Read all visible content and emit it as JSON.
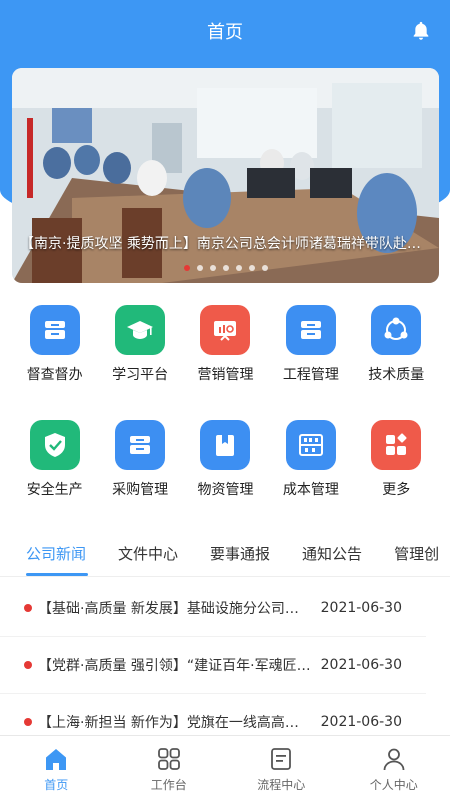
{
  "header": {
    "title": "首页"
  },
  "banner": {
    "caption": "【南京·提质攻坚 乘势而上】南京公司总会计师诸葛瑞祥带队赴前线调研指导",
    "page_count": 7,
    "active_page": 1
  },
  "grid": [
    {
      "label": "督查督办",
      "icon": "tray-icon",
      "color": "#3d8ff2"
    },
    {
      "label": "学习平台",
      "icon": "graduation-cap-icon",
      "color": "#21b97a"
    },
    {
      "label": "营销管理",
      "icon": "presentation-icon",
      "color": "#ef5a4a"
    },
    {
      "label": "工程管理",
      "icon": "tray-icon",
      "color": "#3d8ff2"
    },
    {
      "label": "技术质量",
      "icon": "network-icon",
      "color": "#3d8ff2"
    },
    {
      "label": "安全生产",
      "icon": "shield-check-icon",
      "color": "#21b97a"
    },
    {
      "label": "采购管理",
      "icon": "tray-icon",
      "color": "#3d8ff2"
    },
    {
      "label": "物资管理",
      "icon": "box-icon",
      "color": "#3d8ff2"
    },
    {
      "label": "成本管理",
      "icon": "abacus-icon",
      "color": "#3d8ff2"
    },
    {
      "label": "更多",
      "icon": "apps-icon",
      "color": "#ef5a4a"
    }
  ],
  "tabs": [
    "公司新闻",
    "文件中心",
    "要事通报",
    "通知公告",
    "管理创"
  ],
  "news": [
    {
      "title": "【基础·高质量 新发展】基础设施分公司越来越好",
      "date": "2021-06-30"
    },
    {
      "title": "【党群·高质量 强引领】“建证百年·军魂匠心”",
      "date": "2021-06-30"
    },
    {
      "title": "【上海·新担当 新作为】党旗在一线高高飘扬",
      "date": "2021-06-30"
    }
  ],
  "tabbar": [
    {
      "label": "首页",
      "icon": "home-icon",
      "active": true
    },
    {
      "label": "工作台",
      "icon": "grid-icon",
      "active": false
    },
    {
      "label": "流程中心",
      "icon": "document-icon",
      "active": false
    },
    {
      "label": "个人中心",
      "icon": "user-icon",
      "active": false
    }
  ],
  "colors": {
    "primary": "#3d97f4",
    "accent_red": "#e53935"
  }
}
